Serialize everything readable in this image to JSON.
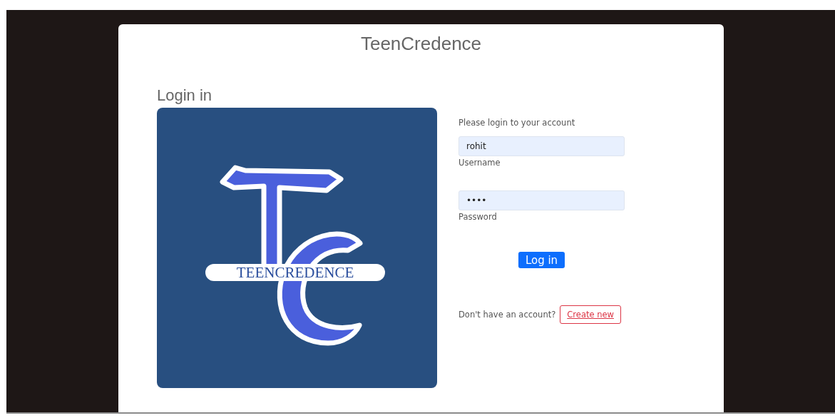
{
  "site_title": "TeenCredence",
  "heading": "Login in",
  "logo": {
    "text": "TEENCREDENCE"
  },
  "form": {
    "intro": "Please login to your account",
    "fields": [
      {
        "label": "Username",
        "value": "rohit"
      },
      {
        "label": "Password",
        "value": "••••"
      }
    ],
    "submit": "Log in",
    "signup_prompt": "Don't have an account?",
    "signup_button": "Create new"
  }
}
